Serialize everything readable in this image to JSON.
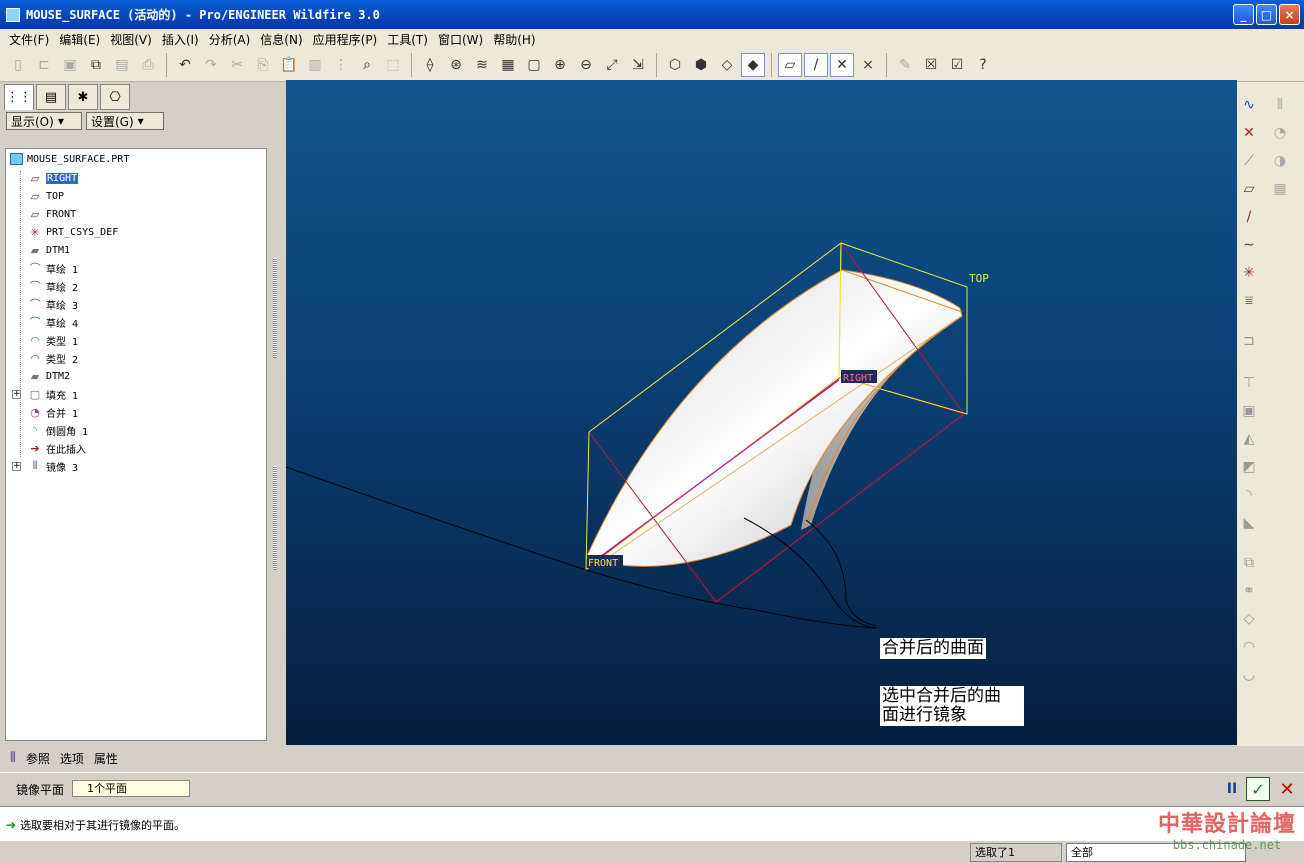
{
  "window": {
    "title": "MOUSE_SURFACE (活动的) - Pro/ENGINEER Wildfire 3.0",
    "buttons": [
      "_",
      "□",
      "×"
    ]
  },
  "menu": [
    "文件(F)",
    "编辑(E)",
    "视图(V)",
    "插入(I)",
    "分析(A)",
    "信息(N)",
    "应用程序(P)",
    "工具(T)",
    "窗口(W)",
    "帮助(H)"
  ],
  "panel": {
    "show_button": "显示(O)",
    "settings_button": "设置(G)",
    "root": "MOUSE_SURFACE.PRT",
    "items": [
      {
        "label": "RIGHT",
        "icon": "datum-plane-icon",
        "selected": true
      },
      {
        "label": "TOP",
        "icon": "datum-plane-icon"
      },
      {
        "label": "FRONT",
        "icon": "datum-plane-icon"
      },
      {
        "label": "PRT_CSYS_DEF",
        "icon": "csys-icon"
      },
      {
        "label": "DTM1",
        "icon": "datum-plane-icon"
      },
      {
        "label": "草绘 1",
        "icon": "sketch-icon"
      },
      {
        "label": "草绘 2",
        "icon": "sketch-icon"
      },
      {
        "label": "草绘 3",
        "icon": "sketch-icon"
      },
      {
        "label": "草绘 4",
        "icon": "sketch-icon"
      },
      {
        "label": "类型 1",
        "icon": "boundary-icon"
      },
      {
        "label": "类型 2",
        "icon": "boundary-icon"
      },
      {
        "label": "DTM2",
        "icon": "datum-plane-icon"
      },
      {
        "label": "填充 1",
        "icon": "fill-icon",
        "expandable": true
      },
      {
        "label": "合并 1",
        "icon": "merge-icon"
      },
      {
        "label": "倒圆角 1",
        "icon": "round-icon"
      },
      {
        "label": "在此插入",
        "icon": "insert-here-arrow-icon"
      },
      {
        "label": "镜像 3",
        "icon": "mirror-icon",
        "expandable": true
      }
    ]
  },
  "viewport": {
    "labels": {
      "top": "TOP",
      "right": "RIGHT",
      "front": "FRONT"
    },
    "annotations": {
      "merged": "合并后的曲面",
      "instruction_line1": "选中合并后的曲",
      "instruction_line2": "面进行镜象"
    }
  },
  "dashboard": {
    "tabs": [
      "参照",
      "选项",
      "属性"
    ],
    "mirror_plane_label": "镜像平面",
    "mirror_plane_value": "1个平面",
    "pause": "II",
    "ok": "✓",
    "cancel": "✕"
  },
  "message": "选取要相对于其进行镜像的平面。",
  "status": {
    "selected": "选取了1",
    "filter": "全部"
  },
  "watermark": {
    "title": "中華設計論壇",
    "url": "bbs.chinade.net"
  }
}
